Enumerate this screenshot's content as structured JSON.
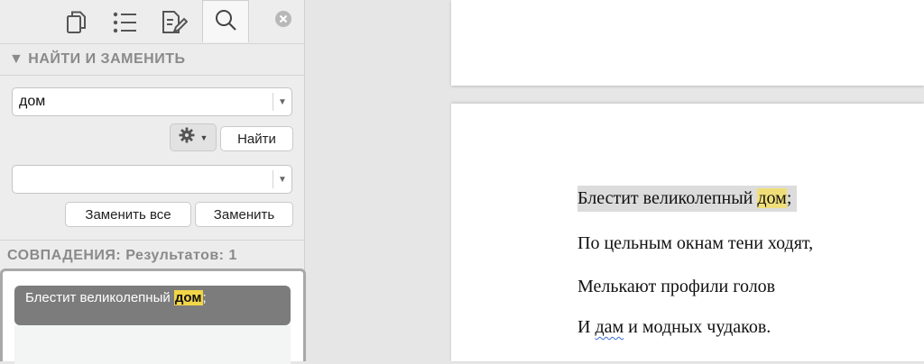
{
  "sidebar": {
    "tabs": [
      {
        "name": "pages",
        "icon": "pages-icon"
      },
      {
        "name": "outline",
        "icon": "list-icon"
      },
      {
        "name": "edit",
        "icon": "edit-icon"
      },
      {
        "name": "search",
        "icon": "search-icon",
        "active": true
      }
    ],
    "close_icon": "close-icon",
    "find_section_title": "▼ НАЙТИ И ЗАМЕНИТЬ",
    "search": {
      "value": "дом",
      "placeholder": ""
    },
    "find_button": "Найти",
    "replace": {
      "value": "",
      "placeholder": ""
    },
    "replace_all_button": "Заменить все",
    "replace_button": "Заменить",
    "matches_title": "СОВПАДЕНИЯ: Результатов: 1",
    "results": [
      {
        "before": "Блестит великолепный ",
        "match": "дом",
        "after": ";"
      }
    ]
  },
  "document": {
    "lines": [
      {
        "before": "Блестит великолепный ",
        "match": "дом",
        "after": ";"
      },
      {
        "text": "По цельным окнам тени ходят,"
      },
      {
        "text": "Мелькают профили голов"
      },
      {
        "before": "И ",
        "spell": "дам",
        "after": " и модных чудаков."
      }
    ]
  },
  "colors": {
    "match_highlight": "#f2d648",
    "result_selected": "#7c7c7c",
    "line_selection": "#dcdcdc"
  }
}
